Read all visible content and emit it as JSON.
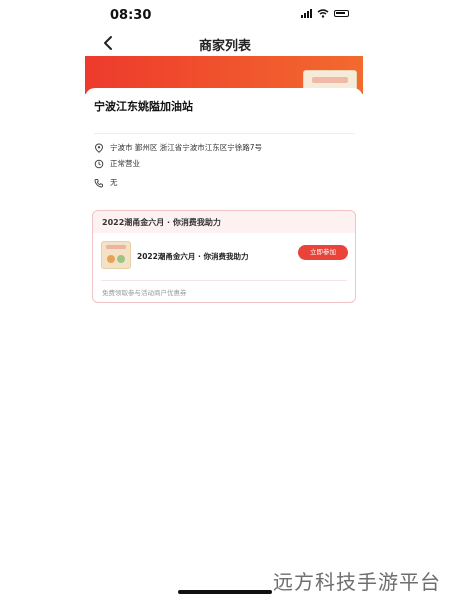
{
  "status_bar": {
    "time": "08:30",
    "icons": [
      "signal-icon",
      "wifi-icon",
      "battery-icon"
    ]
  },
  "nav": {
    "title": "商家列表",
    "back_icon": "chevron-left-icon"
  },
  "store": {
    "name": "宁波江东姚隘加油站",
    "address": "宁波市  鄞州区  浙江省宁波市江东区宁徐路7号",
    "status": "正常营业",
    "phone": "无"
  },
  "promo": {
    "header": "2022潮甬金六月 · 你消费我助力",
    "item_title": "2022潮甬金六月 · 你消费我助力",
    "join_label": "立即参加",
    "footer_text": "免费领取参与活动商户优惠券"
  },
  "watermark": "远方科技手游平台",
  "colors": {
    "banner_red": "#ee3a2c",
    "button_red": "#e9433a",
    "promo_border": "#f0c4c4"
  }
}
